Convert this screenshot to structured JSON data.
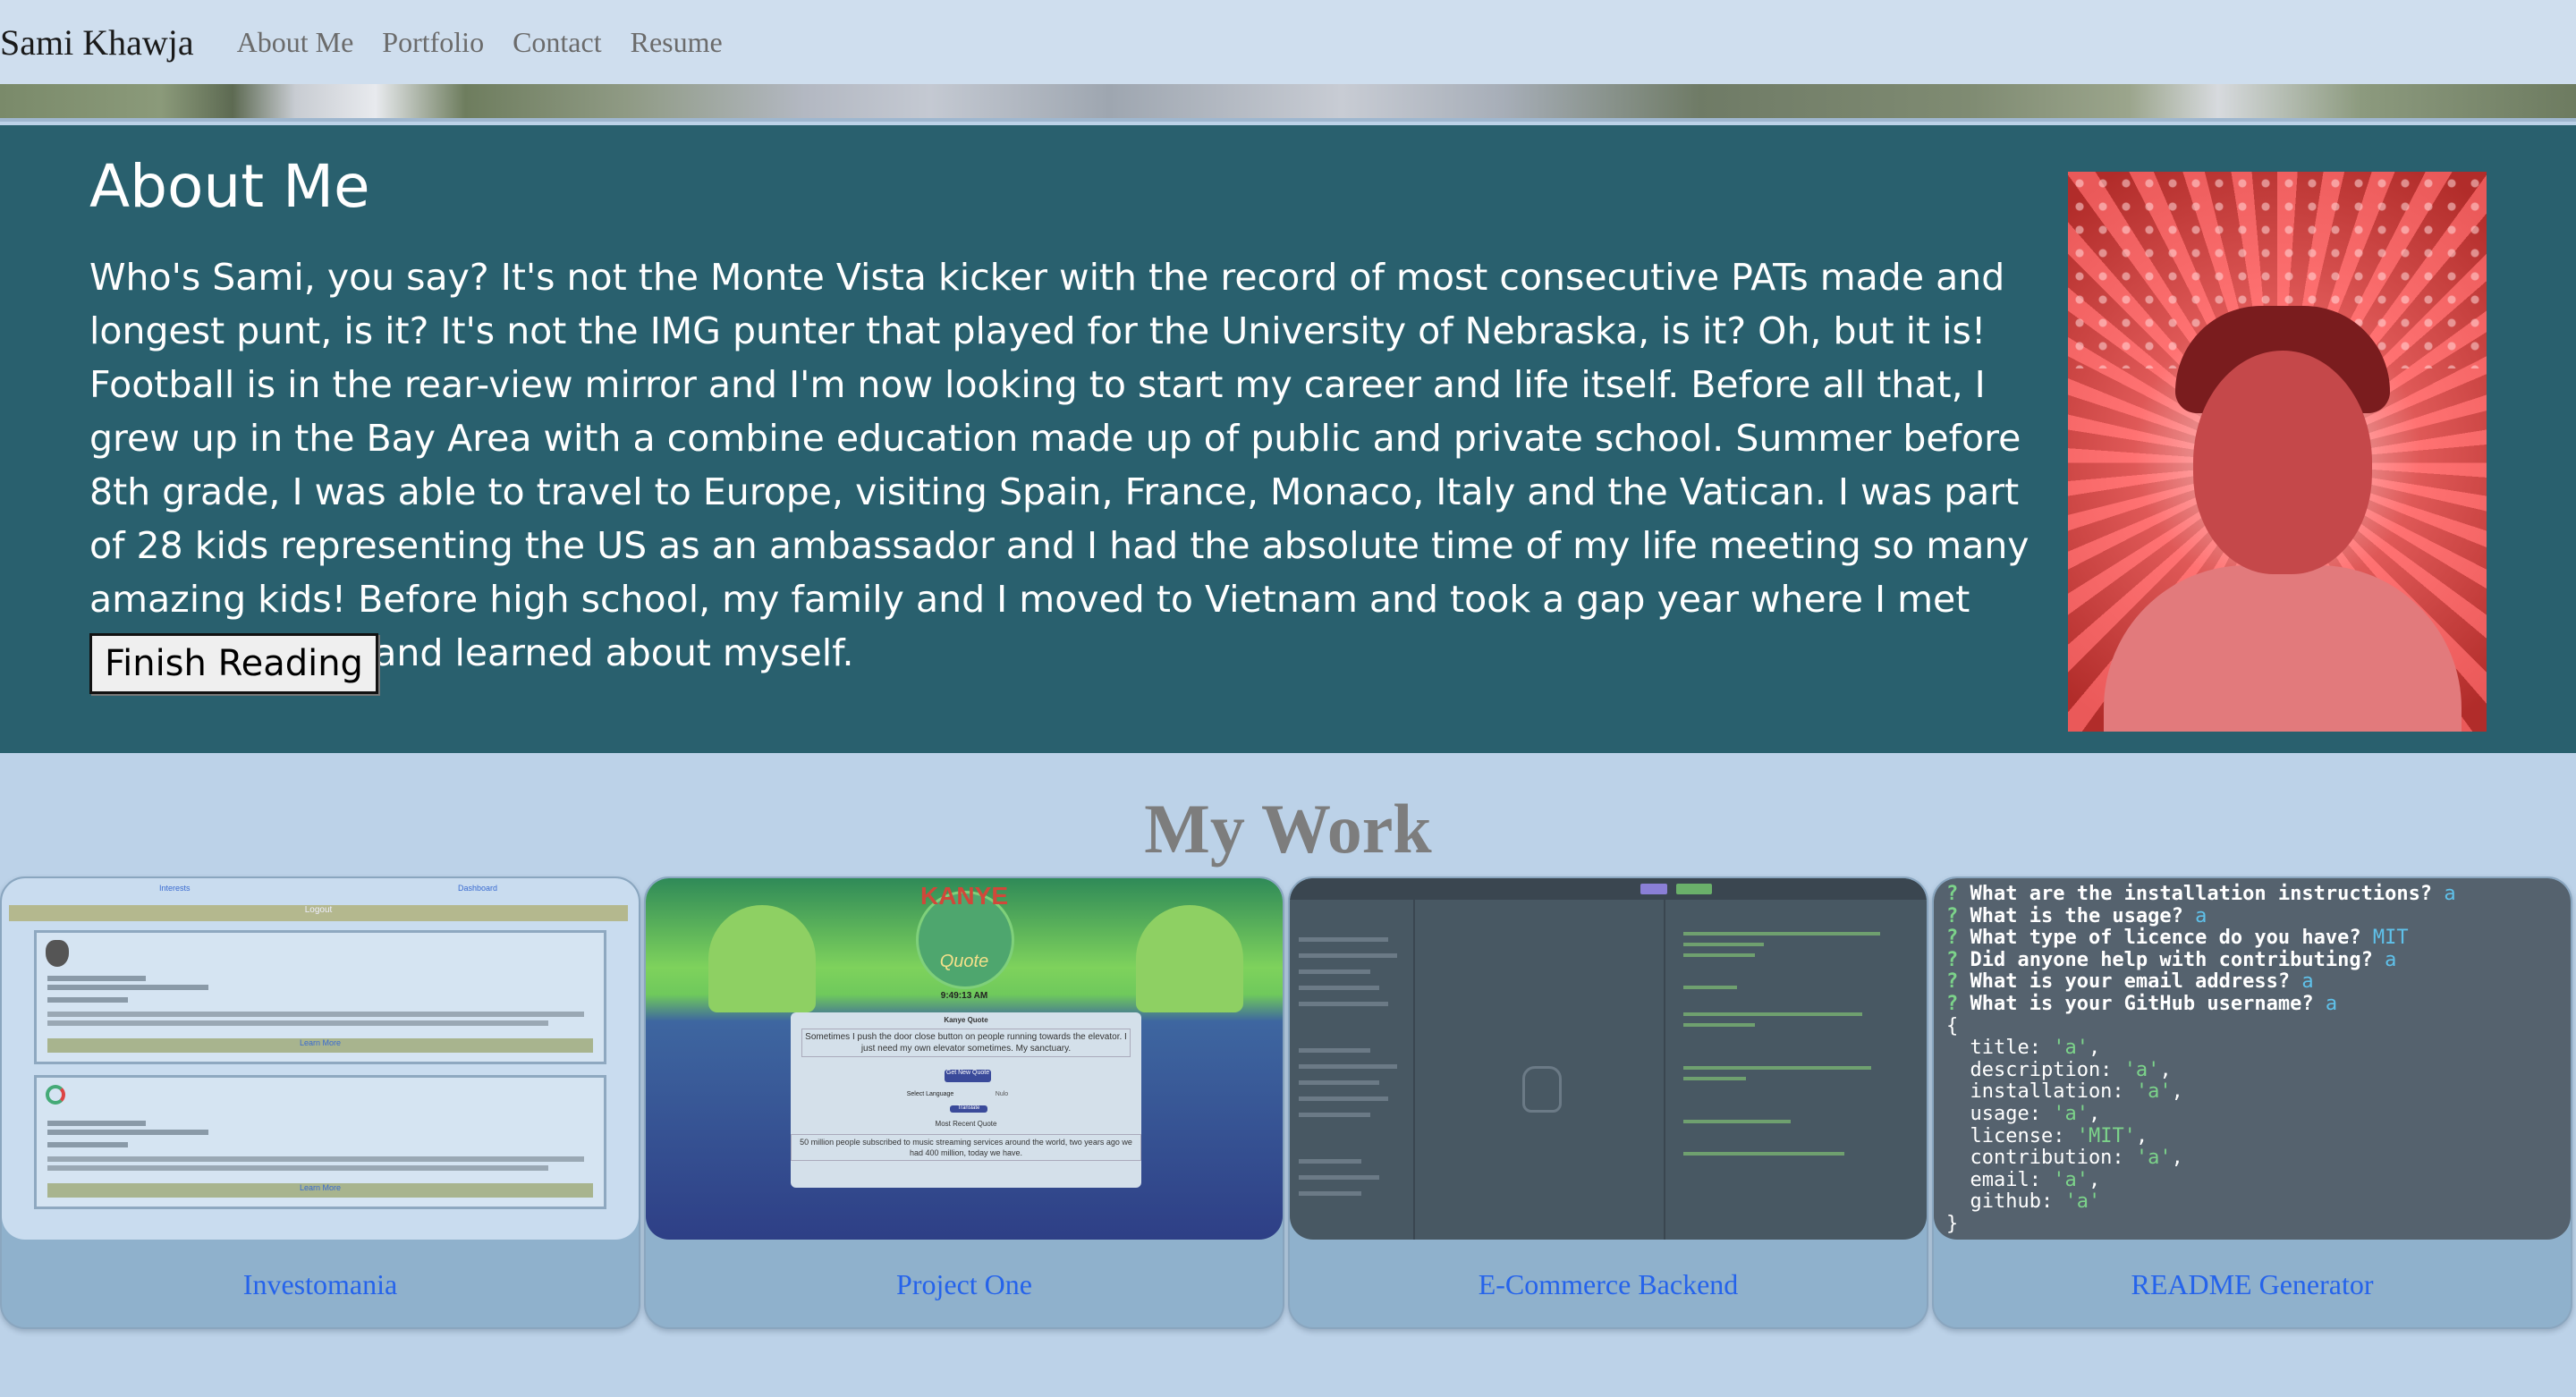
{
  "nav": {
    "brand": "Sami Khawja",
    "links": [
      "About Me",
      "Portfolio",
      "Contact",
      "Resume"
    ]
  },
  "about": {
    "title": "About Me",
    "body": "Who's Sami, you say? It's not the Monte Vista kicker with the record of most consecutive PATs made and longest punt, is it? It's not the IMG punter that played for the University of Nebraska, is it? Oh, but it is! Football is in the rear-view mirror and I'm now looking to start my career and life itself. Before all that, I grew up in the Bay Area with a combine education made up of public and private school. Summer before 8th grade, I was able to travel to Europe, visiting Spain, France, Monaco, Italy and the Vatican. I was part of 28 kids representing the US as an ambassador and I had the absolute time of my life meeting so many amazing kids! Before high school, my family and I moved to Vietnam and took a gap year where I met lifelong friends and learned about myself.",
    "button": "Finish Reading"
  },
  "work": {
    "title": "My Work",
    "projects": [
      {
        "label": "Investomania"
      },
      {
        "label": "Project One"
      },
      {
        "label": "E-Commerce Backend"
      },
      {
        "label": "README Generator"
      }
    ]
  },
  "thumbs": {
    "investomania": {
      "top_links": [
        "Interests",
        "Dashboard"
      ],
      "logout": "Logout",
      "learn_more": "Learn More"
    },
    "kanye": {
      "title": "KANYE",
      "subtitle": "Quote",
      "time": "9:49:13 AM",
      "panel_title": "Kanye Quote",
      "quote": "Sometimes I push the door close button on people running towards the elevator. I just need my own elevator sometimes. My sanctuary.",
      "get_quote": "Get New Quote",
      "select_language": "Select Language",
      "language": "Nulo",
      "translate": "Translate",
      "recent": "Most Recent Quote",
      "recent_quote": "50 million people subscribed to music streaming services around the world, two years ago we had 400 million, today we have."
    },
    "readme": {
      "lines": [
        {
          "q": "?",
          "text": " What are the installation instructions? ",
          "a": "a"
        },
        {
          "q": "?",
          "text": " What is the usage? ",
          "a": "a"
        },
        {
          "q": "?",
          "text": " What type of licence do you have? ",
          "a": "MIT"
        },
        {
          "q": "?",
          "text": " Did anyone help with contributing? ",
          "a": "a"
        },
        {
          "q": "?",
          "text": " What is your email address? ",
          "a": "a"
        },
        {
          "q": "?",
          "text": " What is your GitHub username? ",
          "a": "a"
        }
      ],
      "open_brace": "{",
      "fields": [
        {
          "k": "  title: ",
          "v": "'a'",
          "c": ","
        },
        {
          "k": "  description: ",
          "v": "'a'",
          "c": ","
        },
        {
          "k": "  installation: ",
          "v": "'a'",
          "c": ","
        },
        {
          "k": "  usage: ",
          "v": "'a'",
          "c": ","
        },
        {
          "k": "  license: ",
          "v": "'MIT'",
          "c": ","
        },
        {
          "k": "  contribution: ",
          "v": "'a'",
          "c": ","
        },
        {
          "k": "  email: ",
          "v": "'a'",
          "c": ","
        },
        {
          "k": "  github: ",
          "v": "'a'",
          "c": ""
        }
      ],
      "close_brace": "}"
    }
  }
}
